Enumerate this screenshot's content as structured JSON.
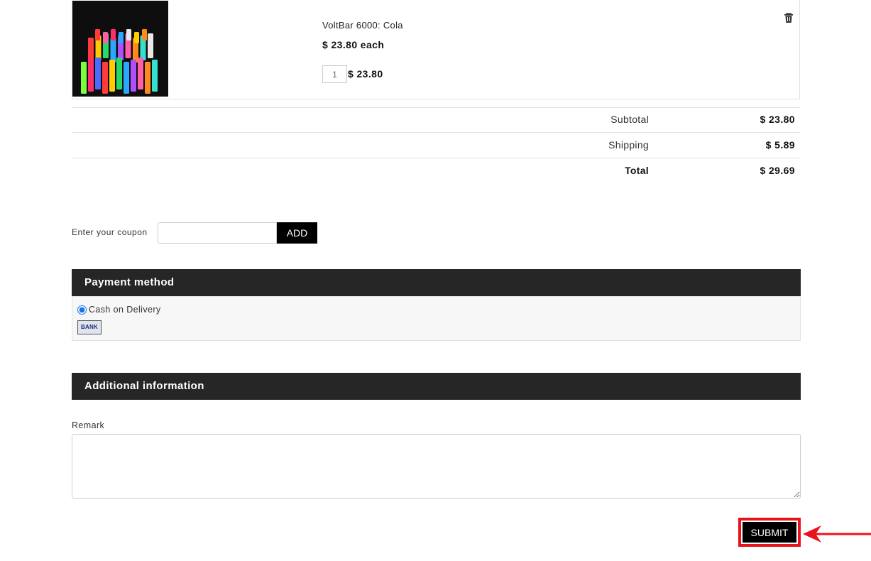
{
  "cart": {
    "item": {
      "name": "VoltBar 6000: Cola",
      "unit_price": "$ 23.80 each",
      "quantity": "1",
      "line_total": "$ 23.80",
      "image_icon": "product-image",
      "delete_icon": "trash-icon"
    },
    "totals": {
      "subtotal_label": "Subtotal",
      "subtotal_value": "$ 23.80",
      "shipping_label": "Shipping",
      "shipping_value": "$ 5.89",
      "total_label": "Total",
      "total_value": "$ 29.69"
    }
  },
  "coupon": {
    "label": "Enter your coupon",
    "value": "",
    "button_label": "ADD"
  },
  "payment": {
    "heading": "Payment method",
    "options": [
      {
        "label": "Cash on Delivery",
        "selected": true
      }
    ],
    "logo_text": "BANK"
  },
  "additional": {
    "heading": "Additional information",
    "remark_label": "Remark",
    "remark_value": ""
  },
  "submit_label": "SUBMIT",
  "colors": {
    "header_bg": "#262626",
    "button_bg": "#000000",
    "highlight": "#e8141b",
    "radio_accent": "#1a73e8"
  }
}
